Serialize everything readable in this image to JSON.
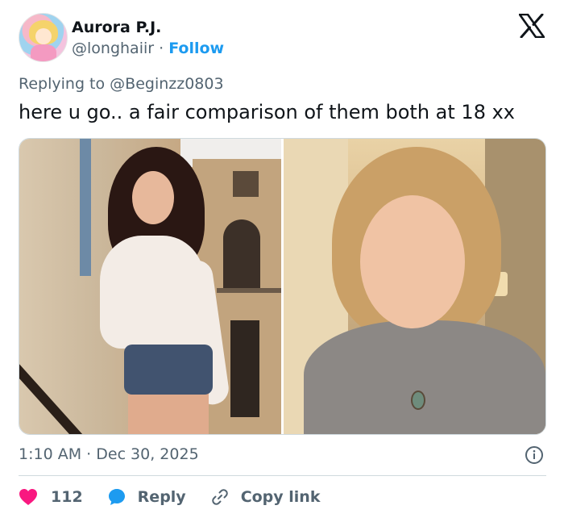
{
  "author": {
    "name": "Aurora P.J.",
    "handle": "@longhaiir",
    "separator": "·",
    "follow_label": "Follow"
  },
  "reply": {
    "prefix": "Replying to",
    "mention": "@Beginzz0803"
  },
  "tweet": {
    "text": "here u go.. a fair comparison of them both at 18 xx"
  },
  "meta": {
    "time": "1:10 AM",
    "separator": "·",
    "date": "Dec 30, 2025"
  },
  "actions": {
    "like_count": "112",
    "reply_label": "Reply",
    "copy_link_label": "Copy link"
  },
  "colors": {
    "like": "#f91880",
    "reply": "#1d9bf0",
    "link": "#1d9bf0",
    "muted": "#536471"
  },
  "icons": [
    "x-logo-icon",
    "info-icon",
    "heart-icon",
    "reply-bubble-icon",
    "link-icon"
  ]
}
